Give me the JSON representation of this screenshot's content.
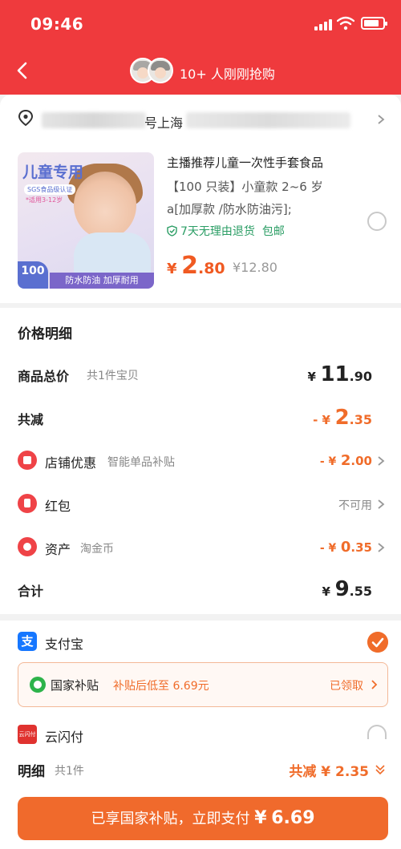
{
  "status_bar": {
    "time": "09:46"
  },
  "header": {
    "title": "10+ 人刚刚抢购"
  },
  "address": {
    "visible_text": "号上海"
  },
  "product": {
    "thumbnail": {
      "title": "儿童专用",
      "badge": "SGS食品级认证",
      "age": "*适用3-12岁",
      "count": "100",
      "band": "防水防油 加厚耐用"
    },
    "title": "主播推荐儿童一次性手套食品",
    "spec_line1": "【100 只装】小童款 2~6 岁",
    "spec_line2": "a[加厚款 /防水防油污];",
    "tag_return": "7天无理由退货",
    "tag_shipping": "包邮",
    "price_currency": "¥",
    "price_int": "2",
    "price_dec": ".80",
    "original_price": "¥12.80"
  },
  "price_detail": {
    "title": "价格明细",
    "total": {
      "label": "商品总价",
      "sub": "共1件宝贝",
      "cur": "¥",
      "int": "11",
      "dec": ".90"
    },
    "discount": {
      "label": "共减",
      "prefix": "- ¥",
      "int": "2",
      "dec": ".35"
    },
    "shop_coupon": {
      "label": "店铺优惠",
      "sub": "智能单品补贴",
      "prefix": "- ¥",
      "int": "2",
      "dec": ".00"
    },
    "red_packet": {
      "label": "红包",
      "value": "不可用"
    },
    "assets": {
      "label": "资产",
      "sub": "淘金币",
      "prefix": "- ¥",
      "int": "0",
      "dec": ".35"
    },
    "sum": {
      "label": "合计",
      "cur": "¥",
      "int": "9",
      "dec": ".55"
    }
  },
  "payment": {
    "alipay_label": "支付宝",
    "alipay_icon_text": "支",
    "subsidy_label": "国家补贴",
    "subsidy_desc": "补贴后低至 6.69元",
    "subsidy_status": "已领取",
    "unionpay_label": "云闪付",
    "unionpay_icon_text": "云闪付"
  },
  "footer": {
    "detail_label": "明细",
    "detail_count": "共1件",
    "detail_value": "共减 ¥ 2.35",
    "pay_label": "已享国家补贴，立即支付",
    "pay_currency": "¥",
    "pay_amount": "6.69"
  },
  "colors": {
    "brand_red": "#ef3a3d",
    "accent_orange": "#f06c2a",
    "green": "#2a9d64"
  }
}
